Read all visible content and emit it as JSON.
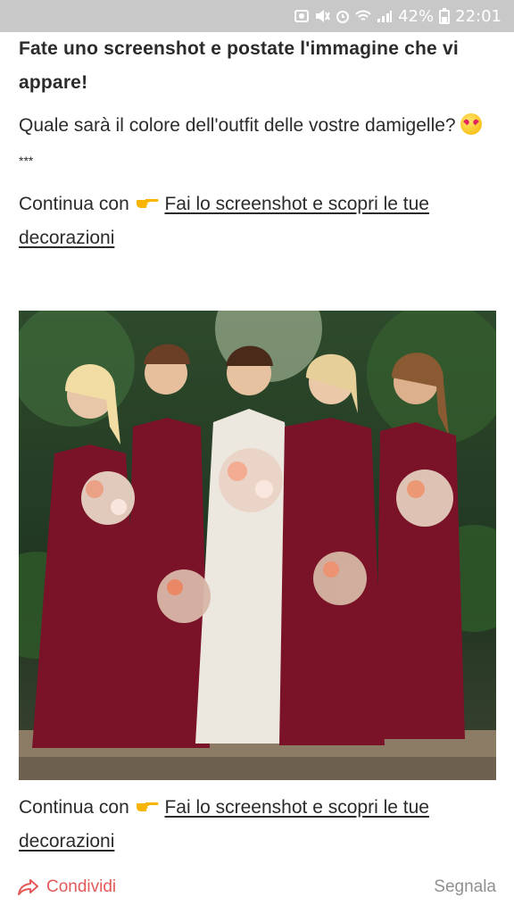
{
  "status_bar": {
    "battery_percent": "42%",
    "time": "22:01"
  },
  "post": {
    "title": "Fate uno screenshot e postate l'immagine che vi appare!",
    "question": "Quale sarà il colore dell'outfit delle vostre damigelle?",
    "separator": "***",
    "continue_prefix": "Continua con",
    "continue_link": "Fai lo screenshot e scopri le tue decorazioni"
  },
  "footer": {
    "share_label": "Condividi",
    "report_label": "Segnala"
  },
  "colors": {
    "accent": "#e35a59",
    "muted": "#8f8f8f",
    "dress": "#7a1328"
  }
}
